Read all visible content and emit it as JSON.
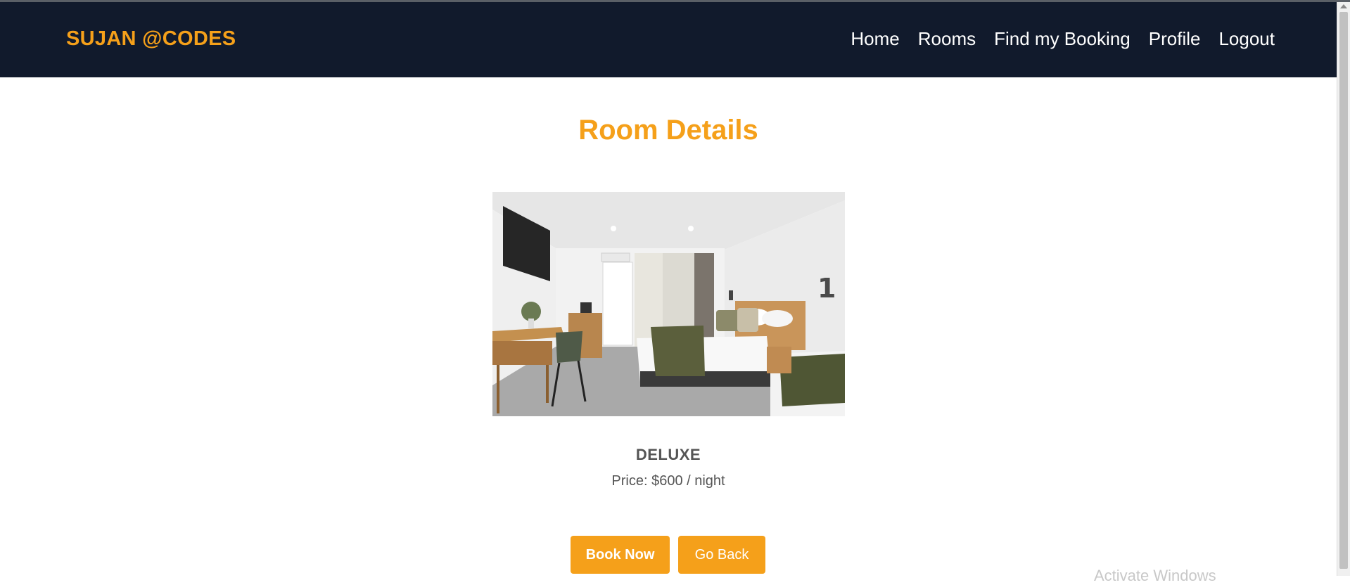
{
  "header": {
    "brand": "SUJAN @CODES",
    "nav": [
      "Home",
      "Rooms",
      "Find my Booking",
      "Profile",
      "Logout"
    ]
  },
  "main": {
    "title": "Room Details",
    "room": {
      "type": "DELUXE",
      "price_text": "Price: $600 / night"
    },
    "buttons": {
      "book": "Book Now",
      "back": "Go Back"
    }
  },
  "overlay": {
    "watermark": "Activate Windows"
  },
  "colors": {
    "accent": "#f5a01a",
    "navbar": "#111a2c",
    "text_muted": "#555555"
  }
}
